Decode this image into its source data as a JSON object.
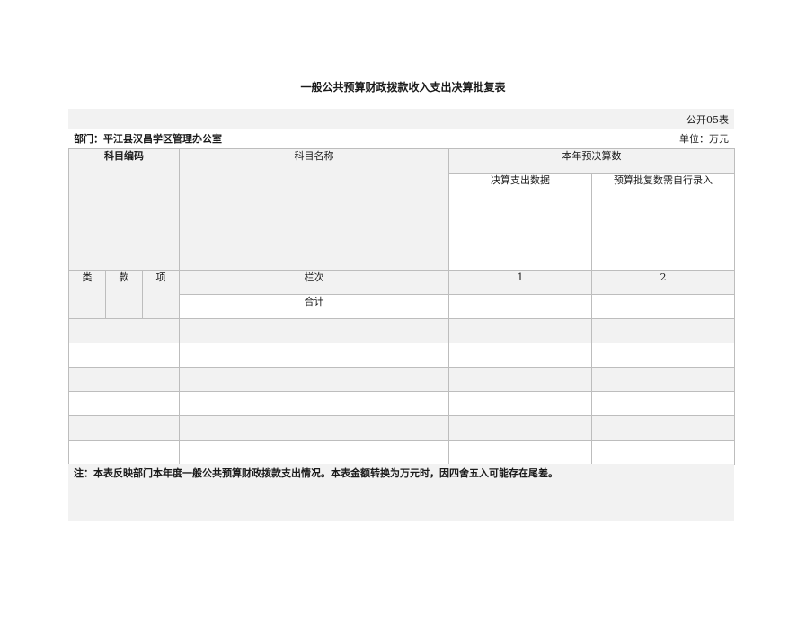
{
  "document": {
    "title": "一般公共预算财政拨款收入支出决算批复表",
    "code": "公开05表",
    "department": "部门：平江县汉昌学区管理办公室",
    "unit": "单位：万元"
  },
  "table": {
    "headers": {
      "subject_code": "科目编码",
      "subject_name": "科目名称",
      "current_year": "本年预决算数",
      "final_expenditure": "决算支出数据",
      "approved_figure": "预算批复数需自行录入",
      "class": "类",
      "section": "款",
      "item": "项",
      "column_no": "栏次",
      "col1": "1",
      "col2": "2",
      "total": "合计"
    },
    "rows": [
      {
        "name": "",
        "col1": "",
        "col2": ""
      },
      {
        "name": "",
        "col1": "",
        "col2": ""
      },
      {
        "name": "",
        "col1": "",
        "col2": ""
      },
      {
        "name": "",
        "col1": "",
        "col2": ""
      },
      {
        "name": "",
        "col1": "",
        "col2": ""
      },
      {
        "name": "",
        "col1": "",
        "col2": ""
      }
    ]
  },
  "note": "注：本表反映部门本年度一般公共预算财政拨款支出情况。本表金额转换为万元时，因四舍五入可能存在尾差。"
}
